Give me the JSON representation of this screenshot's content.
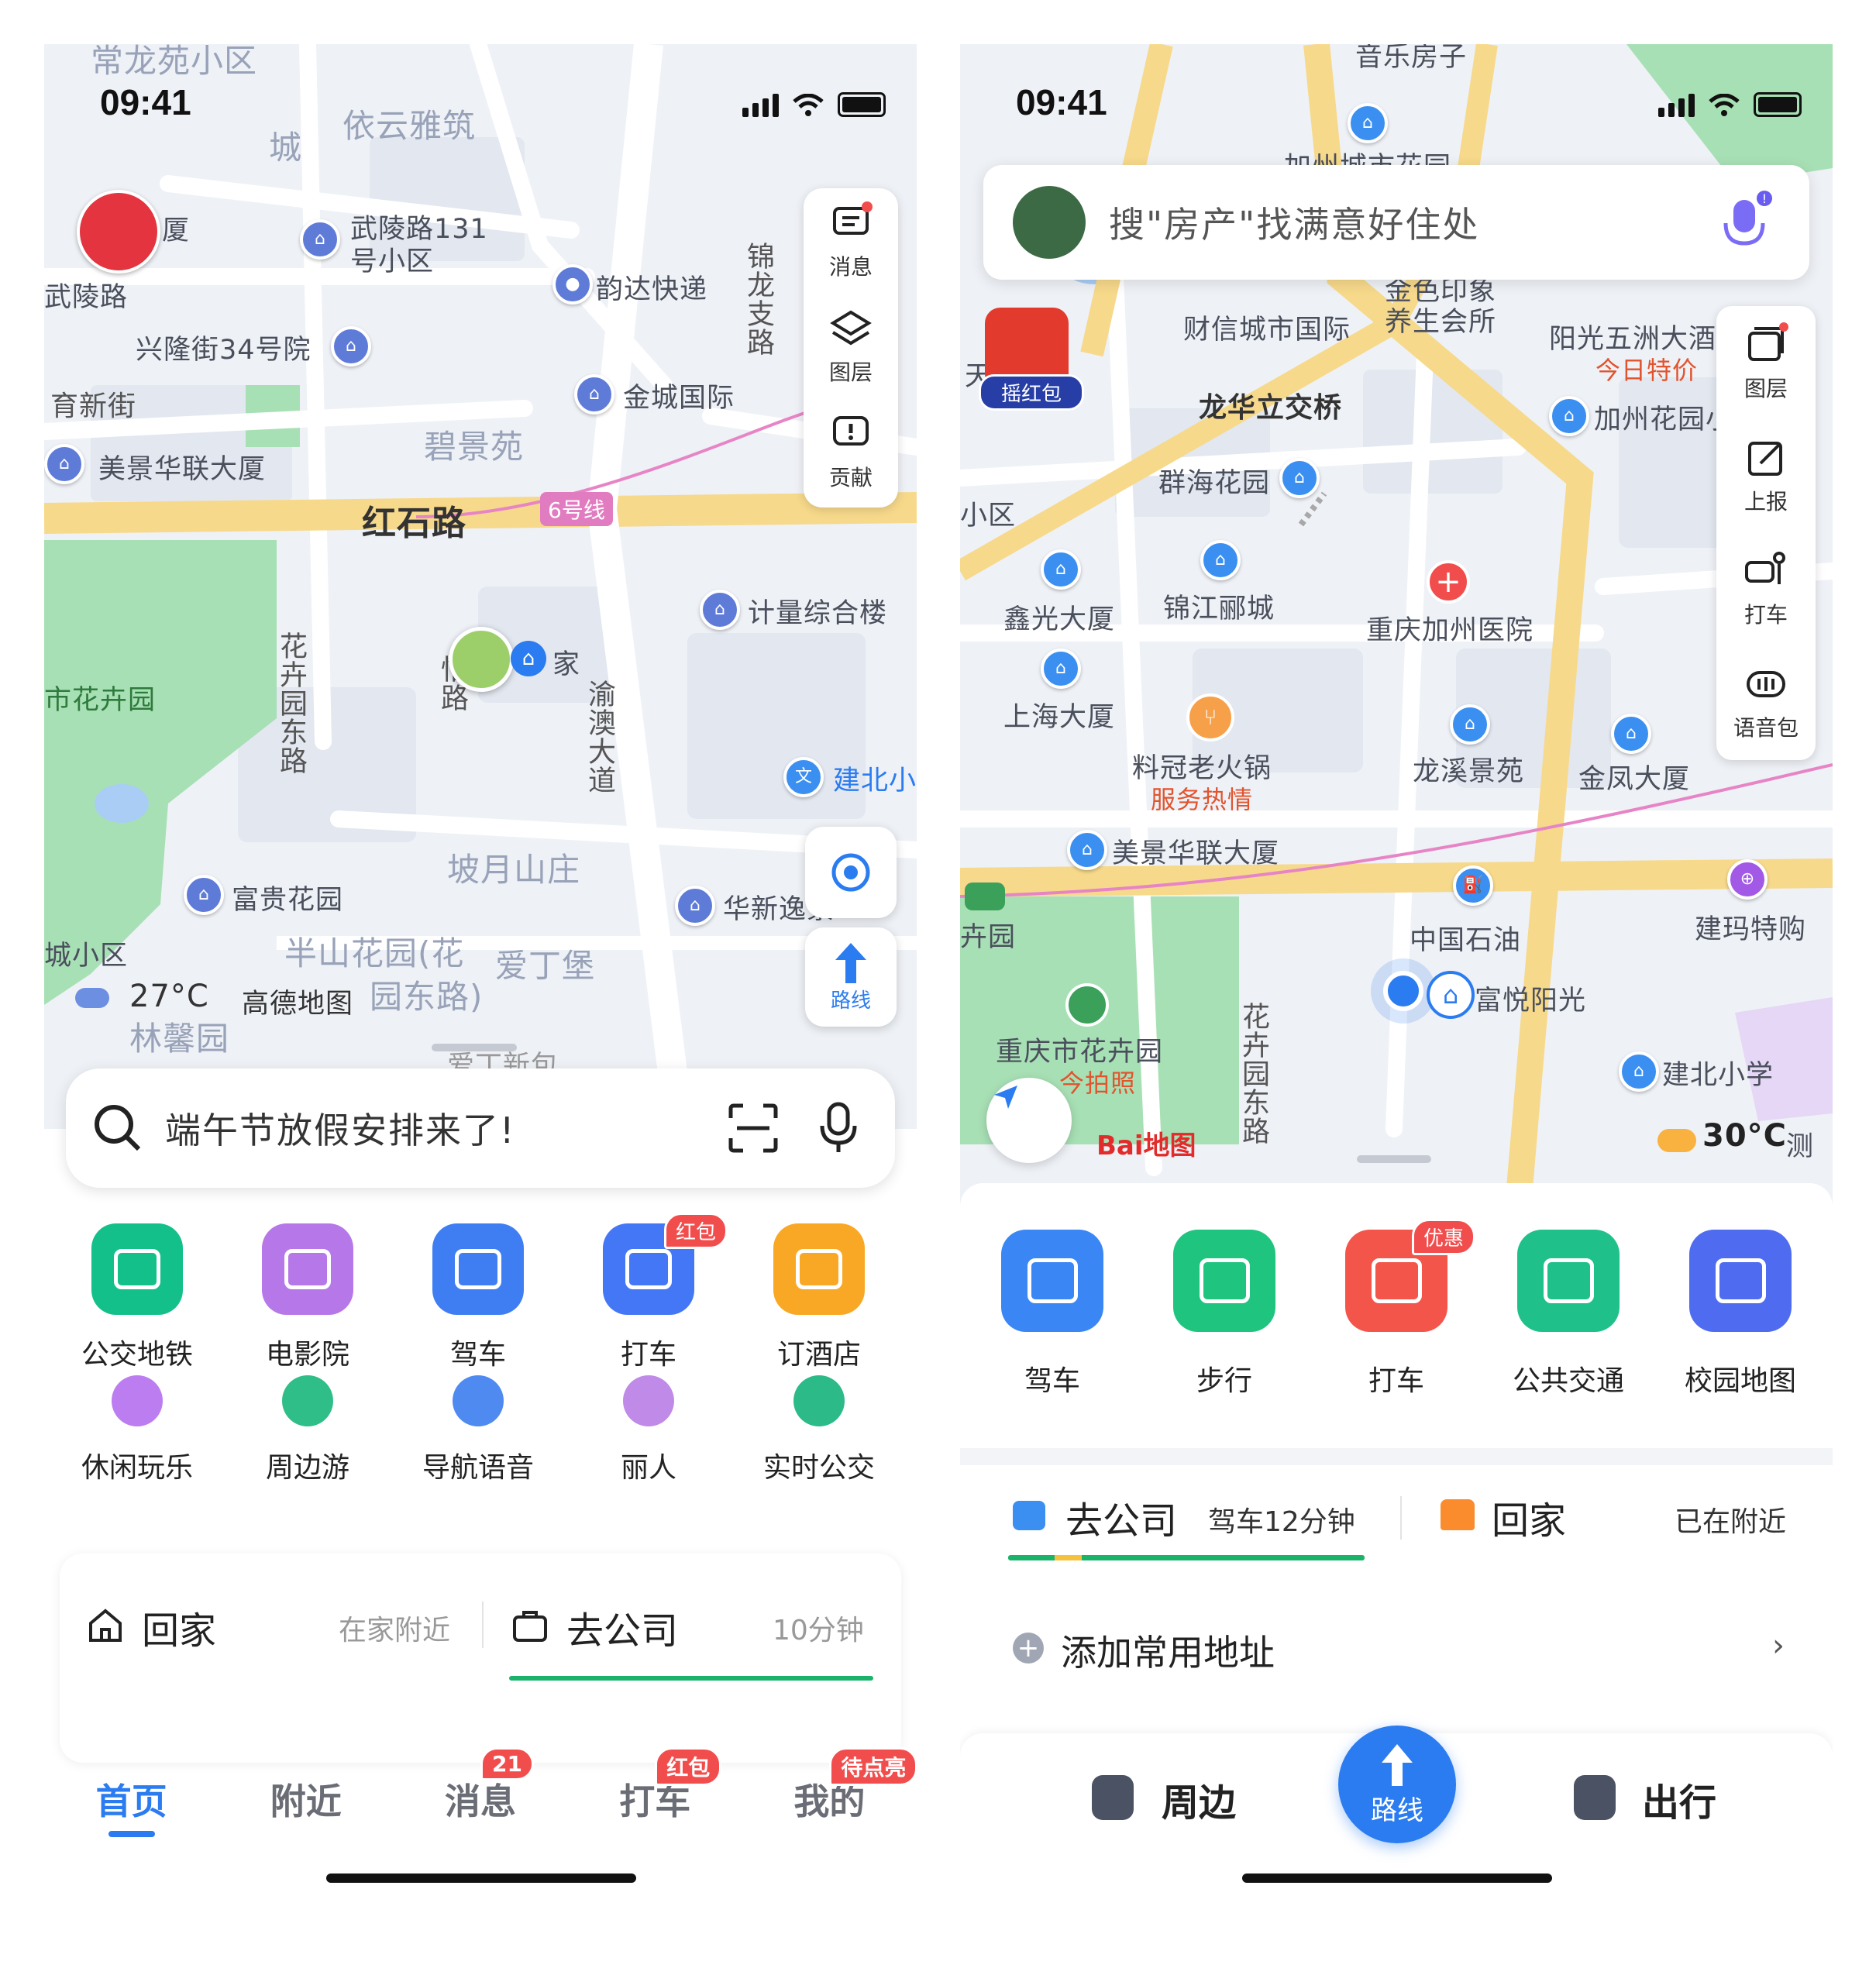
{
  "left": {
    "status": {
      "time": "09:41"
    },
    "map_labels": {
      "l_top": "常龙苑小区",
      "l_city": "城",
      "l_yiyun": "依云雅筑",
      "l_xia": "厦",
      "l_wuling131": "武陵路131",
      "l_xiaoqu": "号小区",
      "l_wulinglu": "武陵路",
      "l_yunda": "韵达快递",
      "l_jinlong": "锦龙支路",
      "l_xinglong": "兴隆街34号院",
      "l_jincheng": "金城国际",
      "l_yuxin": "育新街",
      "l_meijing": "美景华联大厦",
      "l_bijing": "碧景苑",
      "l_hongshi": "红石路",
      "l_line6": "6号线",
      "l_jiliang": "计量综合楼",
      "l_huahui_e": "花卉园东路",
      "l_yilu": "怡路",
      "l_home": "家",
      "l_yuao": "渝澳大道",
      "l_flowerpark": "市花卉园",
      "l_jianbei": "建北小",
      "l_poyue": "坡月山庄",
      "l_fugui": "富贵花园",
      "l_huaxin": "华新逸景",
      "l_chengxiaoqu": "城小区",
      "l_banshan": "半山花园(花",
      "l_aidingbao": "爱丁堡",
      "l_gaode": "高德地图",
      "l_huayuanlu": "园东路)",
      "l_linxin": "林馨园",
      "l_temp": "27°C",
      "l_bottom": "爱丁新包"
    },
    "tools": {
      "message": "消息",
      "layers": "图层",
      "contribute": "贡献",
      "route": "路线"
    },
    "search": {
      "placeholder": "端午节放假安排来了!"
    },
    "grid": [
      {
        "label": "公交地铁",
        "icon": "bus-metro-icon",
        "color": "#14c08a",
        "badge": ""
      },
      {
        "label": "电影院",
        "icon": "film-reel-icon",
        "color": "#b677e8",
        "badge": ""
      },
      {
        "label": "驾车",
        "icon": "car-icon",
        "color": "#3f7ef2",
        "badge": ""
      },
      {
        "label": "打车",
        "icon": "taxi-icon",
        "color": "#4477f5",
        "badge": "红包"
      },
      {
        "label": "订酒店",
        "icon": "hotel-icon",
        "color": "#f9a825",
        "badge": ""
      }
    ],
    "grid2": [
      {
        "label": "休闲玩乐",
        "icon": "cocktail-icon",
        "color": "#b56ff0"
      },
      {
        "label": "周边游",
        "icon": "mountain-pin-icon",
        "color": "#19b77b"
      },
      {
        "label": "导航语音",
        "icon": "nav-voice-icon",
        "color": "#3c7df0"
      },
      {
        "label": "丽人",
        "icon": "beauty-icon",
        "color": "#b87de6"
      },
      {
        "label": "实时公交",
        "icon": "realtime-bus-icon",
        "color": "#15b27c"
      }
    ],
    "commute": {
      "home_label": "回家",
      "home_status": "在家附近",
      "work_label": "去公司",
      "work_status": "10分钟"
    },
    "tabs": [
      {
        "label": "首页",
        "badge": ""
      },
      {
        "label": "附近",
        "badge": ""
      },
      {
        "label": "消息",
        "badge": "21"
      },
      {
        "label": "打车",
        "badge": "红包"
      },
      {
        "label": "我的",
        "badge": "待点亮"
      }
    ]
  },
  "right": {
    "status": {
      "time": "09:41"
    },
    "search": {
      "placeholder": "搜\"房产\"找满意好住处"
    },
    "hongbao": "摇红包",
    "map_labels": {
      "r_top": "音乐房子",
      "r_jiazhou": "加州城市花园",
      "r_jinse": "金色印象",
      "r_yangsheng": "养生会所",
      "r_caixin": "财信城市国际",
      "r_yangguang": "阳光五洲大酒",
      "r_tejia": "今日特价",
      "r_tian": "天",
      "r_longhua": "龙华立交桥",
      "r_jiazhouhy": "加州花园小",
      "r_xiaoqu": "小区",
      "r_qunhai": "群海花园",
      "r_xinguang": "鑫光大厦",
      "r_jinjiang": "锦江郦城",
      "r_hospital": "重庆加州医院",
      "r_shanghai": "上海大厦",
      "r_liaoguan": "料冠老火锅",
      "r_reqing": "服务热情",
      "r_longxi": "龙溪景苑",
      "r_jinfeng": "金凤大厦",
      "r_meijing": "美景华联大厦",
      "r_huiyuan": "卉园",
      "r_zhongshi": "中国石油",
      "r_jianma": "建玛特购",
      "r_fuyue": "富悦阳光",
      "r_cqpark": "重庆市花卉园",
      "r_paizhao": "今拍照",
      "r_huahui_e": "花卉园东路",
      "r_jianbei": "建北小学",
      "r_baidu": "Bai地图",
      "r_temp": "30°C",
      "r_ce": "测"
    },
    "tools": {
      "layers": "图层",
      "report": "上报",
      "taxi": "打车",
      "voice": "语音包"
    },
    "grid": [
      {
        "label": "驾车",
        "icon": "car-icon",
        "color": "#3a86f5",
        "badge": ""
      },
      {
        "label": "步行",
        "icon": "walk-icon",
        "color": "#1fc47f",
        "badge": ""
      },
      {
        "label": "打车",
        "icon": "taxi-icon",
        "color": "#f4554b",
        "badge": "优惠"
      },
      {
        "label": "公共交通",
        "icon": "bus-icon",
        "color": "#20c08a",
        "badge": ""
      },
      {
        "label": "校园地图",
        "icon": "campus-icon",
        "color": "#4f6cf0",
        "badge": ""
      }
    ],
    "commute": {
      "work_label": "去公司",
      "work_status": "驾车12分钟",
      "home_label": "回家",
      "home_status": "已在附近"
    },
    "add_address": "添加常用地址",
    "tabs": {
      "nearby": "周边",
      "route": "路线",
      "travel": "出行"
    }
  }
}
